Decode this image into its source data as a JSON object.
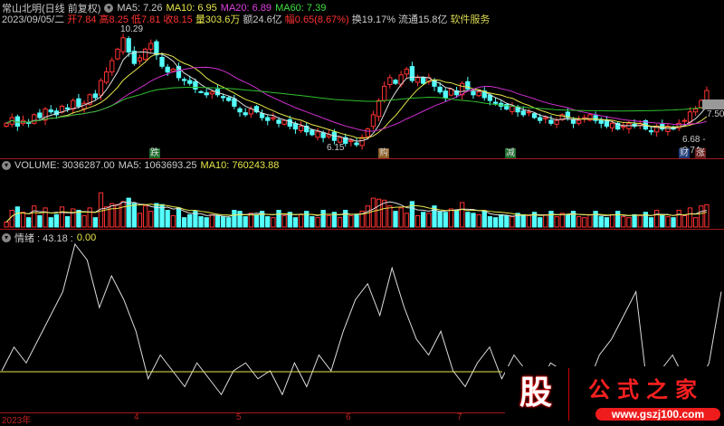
{
  "header": {
    "name": "常山北明(日线 前复权)",
    "ma5": "MA5: 7.26",
    "ma10": "MA10: 6.95",
    "ma20": "MA20: 6.89",
    "ma60": "MA60: 7.39"
  },
  "quote": {
    "date": "2023/09/05/二",
    "open": "开7.84",
    "high": "高8.25",
    "low": "低7.81",
    "close": "收8.15",
    "vol": "量303.6万",
    "amount": "额24.6亿",
    "change": "幅0.65(8.67%)",
    "turnover": "换19.17%",
    "float": "流通15.8亿",
    "service": "软件服务"
  },
  "price_labels": {
    "high": "10.29",
    "low": "6.15",
    "cur": "7.50",
    "range": "6.68 - 6.74"
  },
  "markers": [
    "跌",
    "购",
    "减",
    "财",
    "涨"
  ],
  "volume": {
    "label": "VOLUME: 3036287.00",
    "ma5": "MA5: 1063693.25",
    "ma10": "MA10: 760243.88"
  },
  "sentiment": {
    "label": "情绪 : 43.18 :",
    "value2": "0.00"
  },
  "axis": [
    "2023年",
    "4",
    "5",
    "6",
    "7"
  ],
  "logo": {
    "char": "股",
    "text": "公式之家",
    "url": "www.gszj100.com"
  },
  "chart_data": {
    "type": "candlestick",
    "closes": [
      7.0,
      7.2,
      6.9,
      7.1,
      7.0,
      7.3,
      7.2,
      7.5,
      7.4,
      7.3,
      7.6,
      7.5,
      7.8,
      7.6,
      7.7,
      8.0,
      7.9,
      8.5,
      8.8,
      9.2,
      9.6,
      10.0,
      9.5,
      9.1,
      9.3,
      9.6,
      9.8,
      9.4,
      9.0,
      8.8,
      8.9,
      8.6,
      8.5,
      8.4,
      8.2,
      8.1,
      8.0,
      8.1,
      8.0,
      7.9,
      7.8,
      7.6,
      7.4,
      7.3,
      7.5,
      7.4,
      7.2,
      7.1,
      7.2,
      7.0,
      7.1,
      6.9,
      6.8,
      6.9,
      6.7,
      6.6,
      6.7,
      6.5,
      6.6,
      6.4,
      6.5,
      6.3,
      6.4,
      6.25,
      6.5,
      6.8,
      7.3,
      7.8,
      8.3,
      8.6,
      8.4,
      8.7,
      8.9,
      8.5,
      8.6,
      8.4,
      8.6,
      8.3,
      8.1,
      7.9,
      8.2,
      8.0,
      8.4,
      8.2,
      8.0,
      8.1,
      7.9,
      7.8,
      7.7,
      7.6,
      7.5,
      7.6,
      7.4,
      7.3,
      7.4,
      7.2,
      7.1,
      7.2,
      7.0,
      7.1,
      7.3,
      7.2,
      7.0,
      7.1,
      7.2,
      7.3,
      7.1,
      7.0,
      6.9,
      7.0,
      6.8,
      6.9,
      7.0,
      6.9,
      7.0,
      6.8,
      6.7,
      6.9,
      6.8,
      6.9,
      6.8,
      7.0,
      7.1,
      7.4,
      7.5,
      7.8,
      8.15
    ],
    "price_range": [
      5.9,
      10.5
    ],
    "sentiment": [
      20,
      35,
      25,
      40,
      55,
      70,
      100,
      90,
      60,
      80,
      65,
      45,
      15,
      30,
      20,
      10,
      25,
      15,
      5,
      20,
      25,
      15,
      20,
      5,
      25,
      10,
      30,
      20,
      45,
      65,
      75,
      55,
      85,
      60,
      40,
      30,
      45,
      20,
      10,
      25,
      35,
      15,
      30,
      20,
      10,
      25,
      20,
      15,
      10,
      30,
      40,
      55,
      70,
      5,
      20,
      30,
      15,
      10,
      25,
      70
    ]
  }
}
